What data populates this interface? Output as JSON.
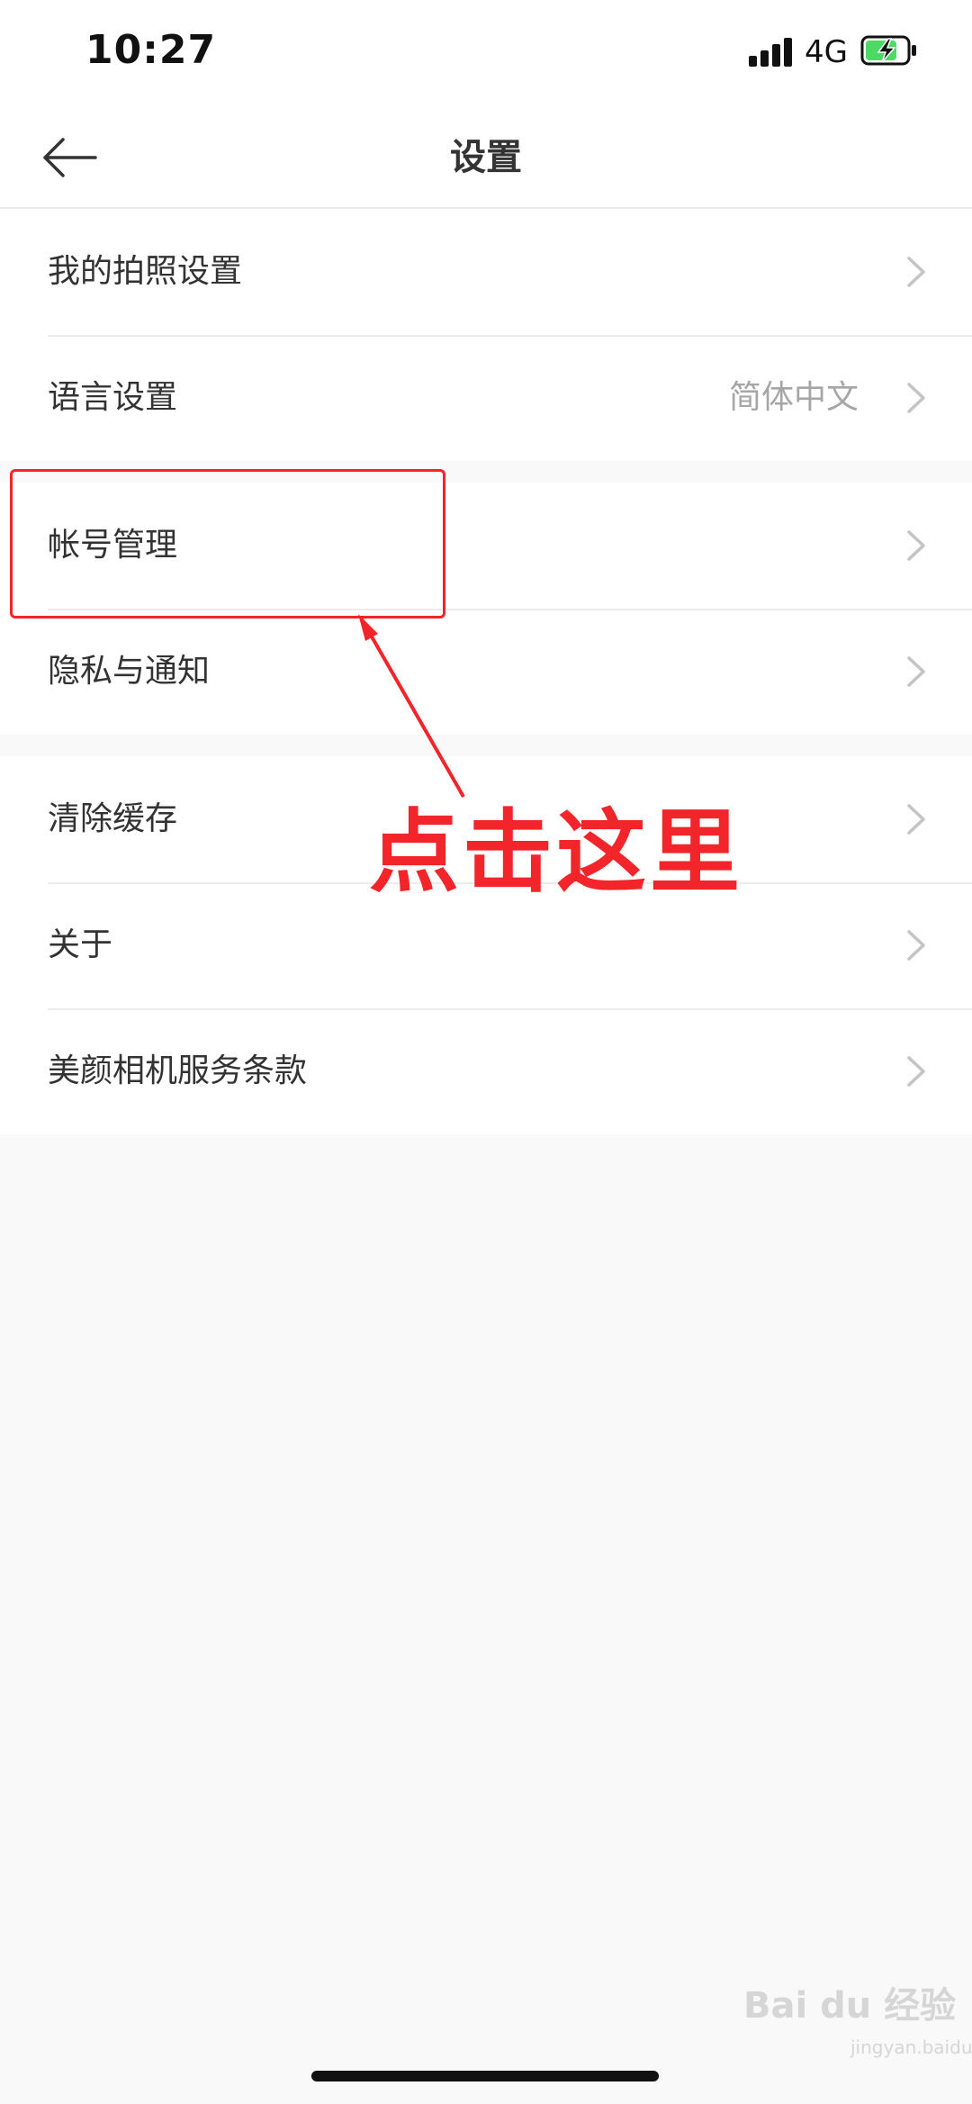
{
  "status_bar": {
    "time": "10:27",
    "network": "4G",
    "battery_color": "#4cd964"
  },
  "nav": {
    "title": "设置",
    "back_icon": "arrow-left-icon"
  },
  "groups": [
    {
      "items": [
        {
          "label": "我的拍照设置",
          "value": ""
        },
        {
          "label": "语言设置",
          "value": "简体中文"
        }
      ]
    },
    {
      "items": [
        {
          "label": "帐号管理",
          "value": ""
        },
        {
          "label": "隐私与通知",
          "value": ""
        }
      ]
    },
    {
      "items": [
        {
          "label": "清除缓存",
          "value": ""
        },
        {
          "label": "关于",
          "value": ""
        },
        {
          "label": "美颜相机服务条款",
          "value": ""
        }
      ]
    }
  ],
  "annotation": {
    "text": "点击这里",
    "color": "#f2262a"
  },
  "watermark": {
    "brand": "Bai du 经验",
    "url": "jingyan.baidu.com"
  }
}
